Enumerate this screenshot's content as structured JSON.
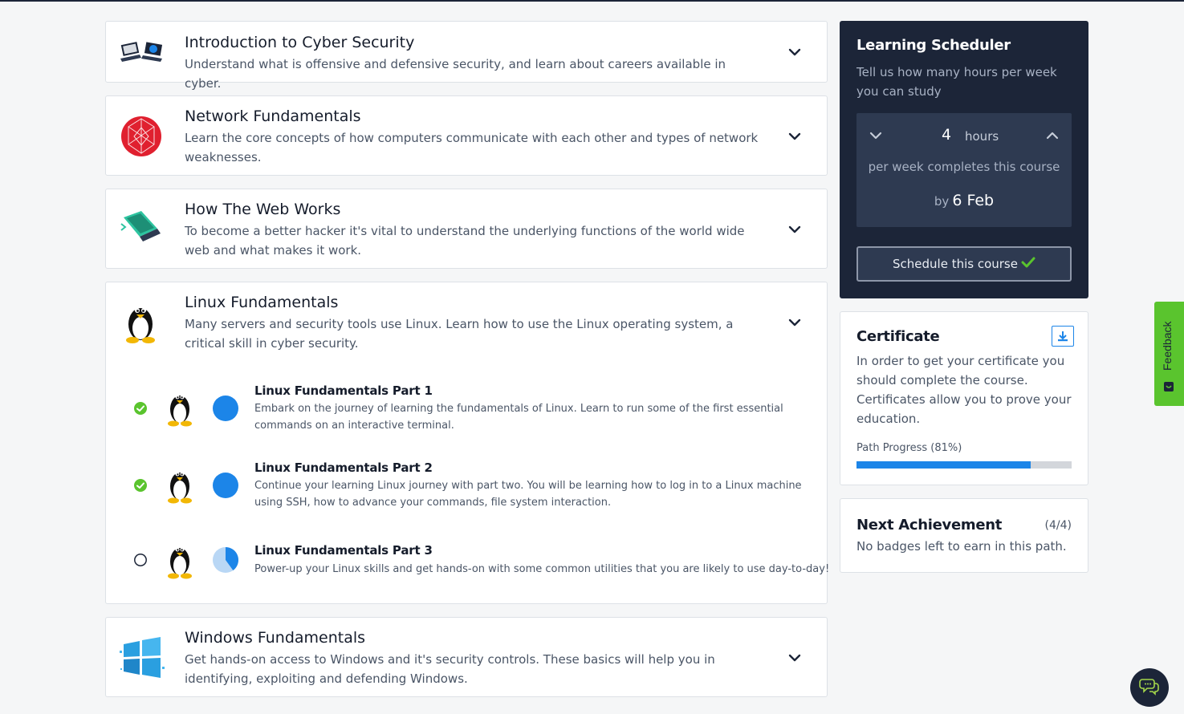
{
  "modules": [
    {
      "title": "Introduction to Cyber Security",
      "description": "Understand what is offensive and defensive security, and learn about careers available in cyber.",
      "icon": "laptops-icon"
    },
    {
      "title": "Network Fundamentals",
      "description": "Learn the core concepts of how computers communicate with each other and types of network weaknesses.",
      "icon": "network-globe-icon"
    },
    {
      "title": "How The Web Works",
      "description": "To become a better hacker it's vital to understand the underlying functions of the world wide web and what makes it work.",
      "icon": "laptop-web-icon"
    },
    {
      "title": "Linux Fundamentals",
      "description": "Many servers and security tools use Linux. Learn how to use the Linux operating system, a critical skill in cyber security.",
      "icon": "tux-icon",
      "rooms": [
        {
          "title": "Linux Fundamentals Part 1",
          "description": "Embark on the journey of learning the fundamentals of Linux. Learn to run some of the first essential commands on an interactive terminal.",
          "completed": true,
          "progress": 1.0
        },
        {
          "title": "Linux Fundamentals Part 2",
          "description": "Continue your learning Linux journey with part two. You will be learning how to log in to a Linux machine using SSH, how to advance your commands, file system interaction.",
          "completed": true,
          "progress": 1.0
        },
        {
          "title": "Linux Fundamentals Part 3",
          "description": "Power-up your Linux skills and get hands-on with some common utilities that you are likely to use day-to-day!",
          "completed": false,
          "progress": 0.4
        }
      ]
    },
    {
      "title": "Windows Fundamentals",
      "description": "Get hands-on access to Windows and it's security controls. These basics will help you in identifying, exploiting and defending Windows.",
      "icon": "windows-icon"
    }
  ],
  "scheduler": {
    "title": "Learning Scheduler",
    "subtitle": "Tell us how many hours per week you can study",
    "hours": "4",
    "hours_unit": "hours",
    "per_week_text": "per week completes this course",
    "by_label": "by",
    "by_date": "6 Feb",
    "button_label": "Schedule this course"
  },
  "certificate": {
    "title": "Certificate",
    "text": "In order to get your certificate you should complete the course. Certificates allow you to prove your education.",
    "progress_label": "Path Progress (81%)",
    "progress": 0.81
  },
  "achievement": {
    "title": "Next Achievement",
    "count": "(4/4)",
    "text": "No badges left to earn in this path."
  },
  "feedback": {
    "label": "Feedback"
  },
  "colors": {
    "accent_blue": "#1c85e8",
    "success_green": "#5ac42e",
    "navy": "#1c2538"
  }
}
